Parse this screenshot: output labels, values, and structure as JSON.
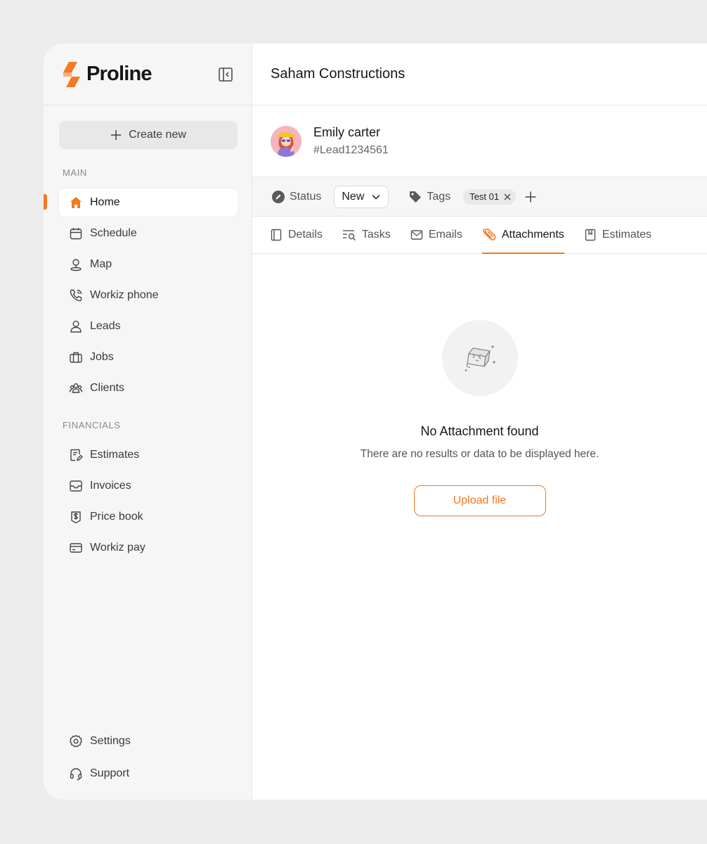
{
  "brand": {
    "name": "Proline",
    "accent_color": "#f47920",
    "collapse_icon": "sidebar-collapse-icon"
  },
  "sidebar": {
    "create_label": "Create new",
    "main_label": "MAIN",
    "main_items": [
      {
        "label": "Home",
        "icon": "home-icon",
        "active": true
      },
      {
        "label": "Schedule",
        "icon": "calendar-icon"
      },
      {
        "label": "Map",
        "icon": "map-pin-icon"
      },
      {
        "label": "Workiz phone",
        "icon": "phone-icon"
      },
      {
        "label": "Leads",
        "icon": "user-icon"
      },
      {
        "label": "Jobs",
        "icon": "briefcase-icon"
      },
      {
        "label": "Clients",
        "icon": "users-icon"
      }
    ],
    "financials_label": "FINANCIALS",
    "financial_items": [
      {
        "label": "Estimates",
        "icon": "document-edit-icon"
      },
      {
        "label": "Invoices",
        "icon": "inbox-icon"
      },
      {
        "label": "Price book",
        "icon": "dollar-badge-icon"
      },
      {
        "label": "Workiz pay",
        "icon": "wallet-icon"
      }
    ],
    "footer_items": [
      {
        "label": "Settings",
        "icon": "gear-icon"
      },
      {
        "label": "Support",
        "icon": "headset-icon"
      }
    ]
  },
  "header": {
    "title": "Saham Constructions"
  },
  "lead": {
    "name": "Emily carter",
    "id": "#Lead1234561"
  },
  "status_bar": {
    "status_label": "Status",
    "status_value": "New",
    "tags_label": "Tags",
    "tags": [
      "Test 01"
    ]
  },
  "tabs": [
    {
      "label": "Details",
      "icon": "panel-icon"
    },
    {
      "label": "Tasks",
      "icon": "task-search-icon"
    },
    {
      "label": "Emails",
      "icon": "mail-icon"
    },
    {
      "label": "Attachments",
      "icon": "paperclip-icon",
      "active": true
    },
    {
      "label": "Estimates",
      "icon": "bookmark-doc-icon"
    }
  ],
  "empty_state": {
    "title": "No Attachment found",
    "subtitle": "There are no results or data to be displayed here.",
    "button_label": "Upload file"
  }
}
